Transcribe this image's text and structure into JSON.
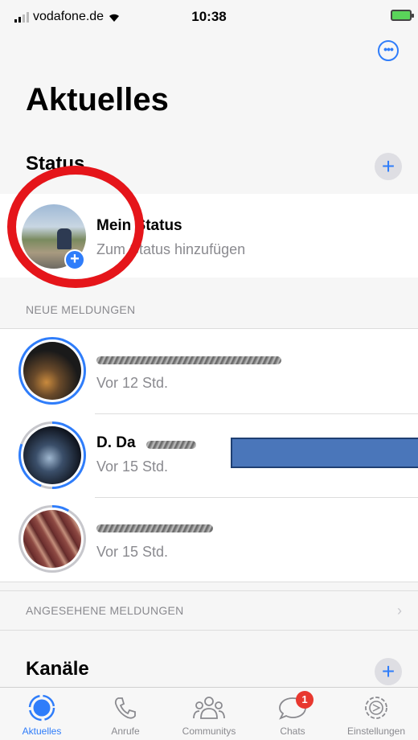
{
  "status_bar": {
    "carrier": "vodafone.de",
    "time": "10:38"
  },
  "header": {
    "title": "Aktuelles"
  },
  "status_section": {
    "title": "Status",
    "my_status": {
      "name": "Mein Status",
      "subtitle": "Zum Status hinzufügen"
    }
  },
  "new_updates": {
    "label": "NEUE MELDUNGEN",
    "items": [
      {
        "name": "",
        "time": "Vor 12 Std."
      },
      {
        "name": "D. Da",
        "time": "Vor 15 Std."
      },
      {
        "name": "",
        "time": "Vor 15 Std."
      }
    ]
  },
  "seen_updates": {
    "label": "ANGESEHENE MELDUNGEN"
  },
  "channels": {
    "title": "Kanäle"
  },
  "tabbar": {
    "tabs": [
      {
        "label": "Aktuelles",
        "icon": "updates-icon",
        "active": true
      },
      {
        "label": "Anrufe",
        "icon": "phone-icon"
      },
      {
        "label": "Communitys",
        "icon": "communities-icon"
      },
      {
        "label": "Chats",
        "icon": "chat-icon",
        "badge": "1"
      },
      {
        "label": "Einstellungen",
        "icon": "gear-icon"
      }
    ]
  },
  "colors": {
    "accent": "#2f7dfa",
    "highlight_ring": "#e5151a",
    "badge": "#e8382f",
    "redaction_box": "#4a76ba"
  }
}
